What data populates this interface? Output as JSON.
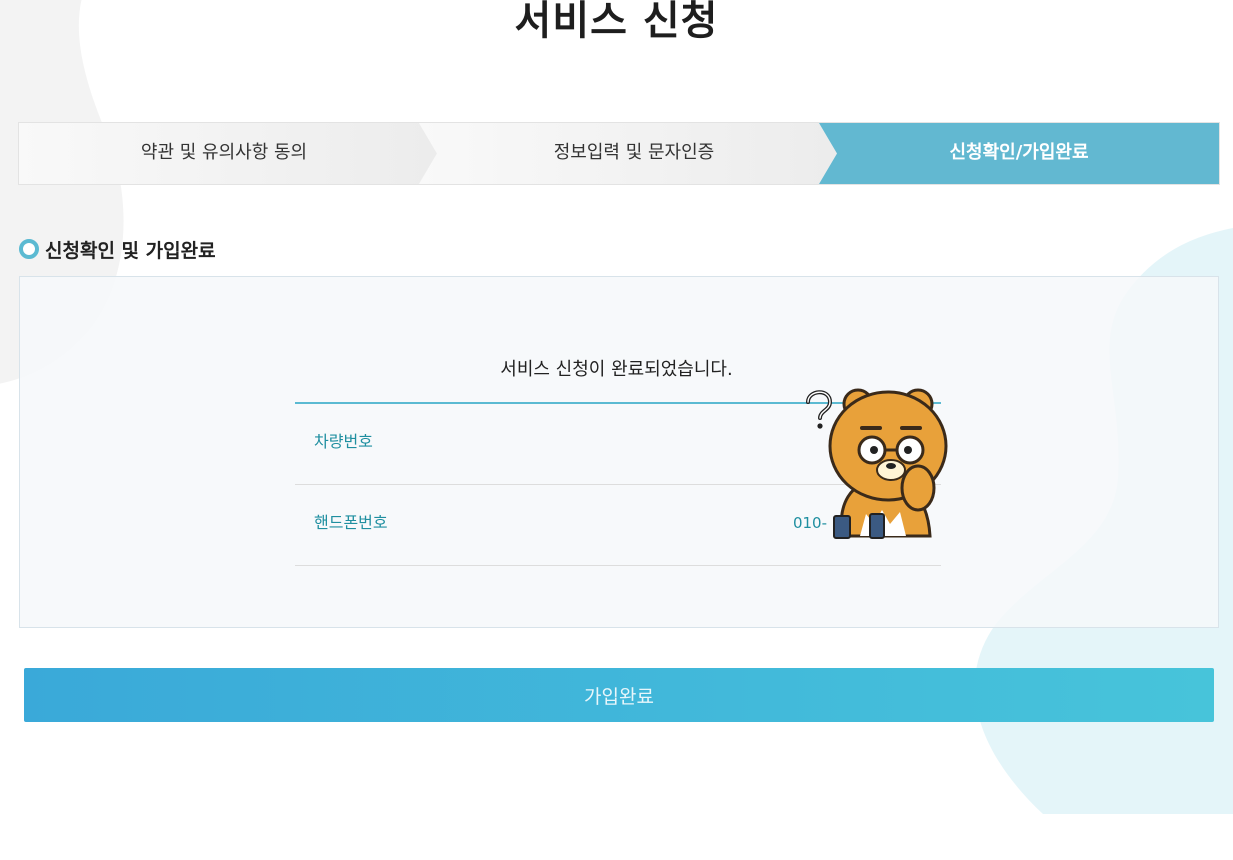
{
  "page": {
    "title": "서비스 신청"
  },
  "steps": [
    {
      "label": "약관 및 유의사항 동의",
      "active": false
    },
    {
      "label": "정보입력 및 문자인증",
      "active": false
    },
    {
      "label": "신청확인/가입완료",
      "active": true
    }
  ],
  "section": {
    "title": "신청확인 및 가입완료"
  },
  "result": {
    "message": "서비스 신청이 완료되었습니다.",
    "rows": [
      {
        "label": "차량번호",
        "value": ""
      },
      {
        "label": "핸드폰번호",
        "value": "010-"
      }
    ]
  },
  "actions": {
    "submit_label": "가입완료"
  },
  "colors": {
    "accent": "#5bbad2",
    "active_step": "#62b8d1",
    "button_start": "#3aa9d9",
    "button_end": "#47c4da",
    "row_text": "#1f8fa0"
  },
  "icons": {
    "section_marker": "ring-icon",
    "mascot": "confused-bear-mascot-icon"
  }
}
